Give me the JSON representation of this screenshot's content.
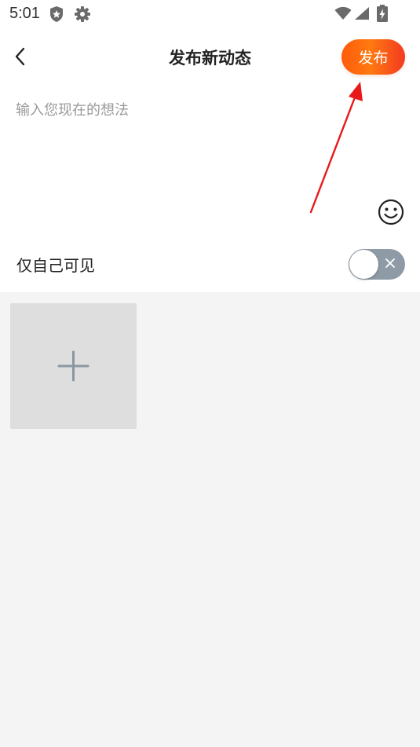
{
  "status_bar": {
    "time": "5:01",
    "icons": [
      "shield-icon",
      "gear-icon",
      "wifi-icon",
      "signal-icon",
      "battery-charging-icon"
    ]
  },
  "header": {
    "back_icon": "chevron-left-icon",
    "title": "发布新动态",
    "publish_label": "发布"
  },
  "compose": {
    "placeholder": "输入您现在的想法",
    "value": "",
    "emoji_icon": "smiley-icon"
  },
  "privacy": {
    "label": "仅自己可见",
    "enabled": false,
    "toggle_icon": "close-icon"
  },
  "media": {
    "add_icon": "plus-icon"
  },
  "colors": {
    "accent_start": "#ff5a0a",
    "accent_end": "#f33a20",
    "annotation_arrow": "#e8191a",
    "toggle_off": "#8e9ba6",
    "page_bg": "#f4f4f4"
  }
}
